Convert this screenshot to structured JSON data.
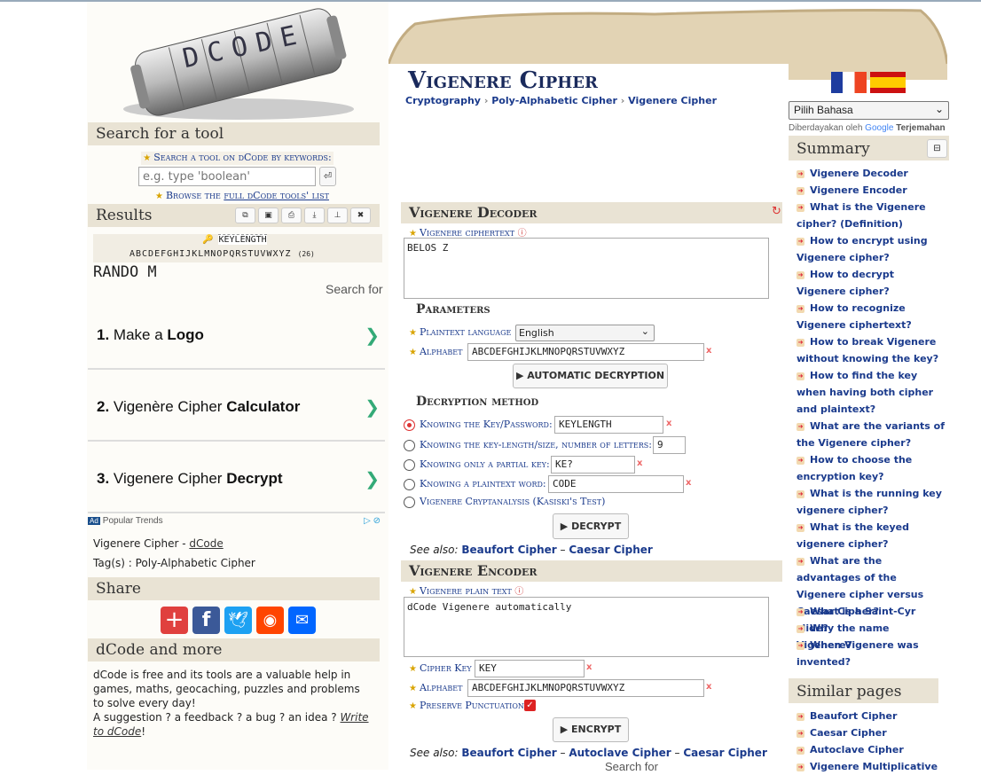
{
  "logo": {
    "text": "DCODE"
  },
  "search": {
    "title": "Search for a tool",
    "hint": "Search a tool on dCode by keywords:",
    "placeholder": "e.g. type 'boolean'",
    "go": "⏎",
    "browse_prefix": "Browse the",
    "browse_link": "full dCode tools' list"
  },
  "results": {
    "title": "Results",
    "key": "KEYLENGTH",
    "alphabet": "ABCDEFGHIJKLMNOPQRSTUVWXYZ",
    "count": "(26)",
    "output": "RANDO M"
  },
  "ad_left": {
    "search_for": "Search for",
    "items": [
      {
        "num": "1.",
        "text": "Make a ",
        "bold": "Logo"
      },
      {
        "num": "2.",
        "text": "Vigenère Cipher ",
        "bold": "Calculator"
      },
      {
        "num": "3.",
        "text": "Vigenere Cipher ",
        "bold": "Decrypt"
      }
    ],
    "badge": "Ad",
    "source": "Popular Trends"
  },
  "meta": {
    "page_prefix": "Vigenere Cipher - ",
    "page_link": "dCode",
    "tags": "Tag(s) : Poly-Alphabetic Cipher"
  },
  "share": {
    "title": "Share"
  },
  "more": {
    "title": "dCode and more",
    "body": "dCode is free and its tools are a valuable help in games, maths, geocaching, puzzles and problems to solve every day!",
    "suggestion": "A suggestion ? a feedback ? a bug ? an idea ?",
    "write": "Write to dCode",
    "end": "!"
  },
  "header": {
    "title": "Vigenere Cipher",
    "crumbs": [
      "Cryptography",
      "Poly-Alphabetic Cipher",
      "Vigenere Cipher"
    ],
    "lang_select": "Pilih Bahasa",
    "powered": "Diberdayakan oleh",
    "google": "Google",
    "translate": "Terjemahan"
  },
  "decoder": {
    "title": "Vigenere Decoder",
    "cipher_label": "Vigenere ciphertext",
    "cipher_value": "BELOS Z",
    "params": "Parameters",
    "lang_label": "Plaintext language",
    "lang_value": "English",
    "alpha_label": "Alphabet",
    "alpha_value": "ABCDEFGHIJKLMNOPQRSTUVWXYZ",
    "auto": "▶ AUTOMATIC DECRYPTION",
    "method": "Decryption method",
    "opt1": "Knowing the Key/Password:",
    "opt1_val": "KEYLENGTH",
    "opt2": "Knowing the key-length/size, number of letters:",
    "opt2_val": "9",
    "opt3": "Knowing only a partial key:",
    "opt3_val": "KE?",
    "opt4": "Knowing a plaintext word:",
    "opt4_val": "CODE",
    "opt5": "Vigenere Cryptanalysis (Kasiski's Test)",
    "decrypt": "▶ DECRYPT",
    "see": "See also:",
    "see1": "Beaufort Cipher",
    "see2": "Caesar Cipher"
  },
  "encoder": {
    "title": "Vigenere Encoder",
    "plain_label": "Vigenere plain text",
    "plain_value": "dCode Vigenere automatically",
    "key_label": "Cipher Key",
    "key_value": "KEY",
    "alpha_label": "Alphabet",
    "alpha_value": "ABCDEFGHIJKLMNOPQRSTUVWXYZ",
    "punct_label": "Preserve Punctuation",
    "encrypt": "▶ ENCRYPT",
    "see": "See also:",
    "see1": "Beaufort Cipher",
    "see2": "Autoclave Cipher",
    "see3": "Caesar Cipher"
  },
  "summary": {
    "title": "Summary",
    "collapse": "⊟",
    "items": [
      "Vigenere Decoder",
      "Vigenere Encoder",
      "What is the Vigenere cipher? (Definition)",
      "How to encrypt using Vigenere cipher?",
      "How to decrypt Vigenere cipher?",
      "How to recognize Vigenere ciphertext?",
      "How to break Vigenere without knowing the key?",
      "How to find the key when having both cipher and plaintext?",
      "What are the variants of the Vigenere cipher?",
      "How to choose the encryption key?",
      "What is the running key vigenere cipher?",
      "What is the keyed vigenere cipher?",
      "What are the advantages of the Vigenere cipher versus Caesar Cipher?",
      "What is a Saint-Cyr slide?",
      "Why the name Vigenere?",
      "When Vigenere was invented?"
    ]
  },
  "similar": {
    "title": "Similar pages",
    "items": [
      "Beaufort Cipher",
      "Caesar Cipher",
      "Autoclave Cipher",
      "Vigenere Multiplicative"
    ]
  },
  "bottom_search": "Search for"
}
